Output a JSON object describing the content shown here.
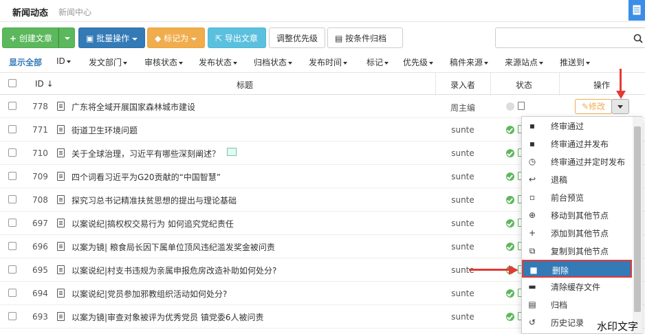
{
  "header": {
    "title": "新闻动态",
    "breadcrumb": "新闻中心"
  },
  "toolbar": {
    "create": "创建文章",
    "batch": "批量操作",
    "mark_as": "标记为",
    "export": "导出文章",
    "priority": "调整优先级",
    "archive": "按条件归档",
    "search_placeholder": ""
  },
  "filters": [
    "显示全部",
    "ID",
    "发文部门",
    "审核状态",
    "发布状态",
    "归档状态",
    "发布时间",
    "标记",
    "优先级",
    "稿件来源",
    "来源站点",
    "推送到"
  ],
  "table": {
    "headers": {
      "id": "ID",
      "title": "标题",
      "author": "录入者",
      "status": "状态",
      "action": "操作"
    },
    "rows": [
      {
        "id": "778",
        "title": "广东将全域开展国家森林城市建设",
        "author": "周主编"
      },
      {
        "id": "771",
        "title": "街道卫生环境问题",
        "author": "sunte"
      },
      {
        "id": "710",
        "title": "关于全球治理，习近平有哪些深刻阐述？",
        "author": "sunte"
      },
      {
        "id": "709",
        "title": "四个词看习近平为G20贡献的“中国智慧”",
        "author": "sunte"
      },
      {
        "id": "708",
        "title": "探究习总书记精准扶贫思想的提出与理论基础",
        "author": "sunte"
      },
      {
        "id": "697",
        "title": "以案说纪|搞权权交易行为 如何追究党纪责任",
        "author": "sunte"
      },
      {
        "id": "696",
        "title": "以案为镜| 粮食局长因下属单位顶风违纪滥发奖金被问责",
        "author": "sunte"
      },
      {
        "id": "695",
        "title": "以案说纪|村支书违规为亲属申报危房改造补助如何处分?",
        "author": "sunte"
      },
      {
        "id": "694",
        "title": "以案说纪|党员参加邪教组织活动如何处分?",
        "author": "sunte"
      },
      {
        "id": "693",
        "title": "以案为镜|审查对象被评为优秀党员 镇党委6人被问责",
        "author": "sunte"
      }
    ],
    "edit_label": "修改"
  },
  "menu": {
    "items": [
      {
        "label": "终审通过",
        "icon": "approve-icon"
      },
      {
        "label": "终审通过并发布",
        "icon": "approve-publish-icon"
      },
      {
        "label": "终审通过并定时发布",
        "icon": "clock-icon"
      },
      {
        "label": "退稿",
        "icon": "return-icon"
      },
      {
        "label": "前台预览",
        "icon": "preview-icon"
      },
      {
        "label": "移动到其他节点",
        "icon": "move-icon"
      },
      {
        "label": "添加到其他节点",
        "icon": "plus-icon"
      },
      {
        "label": "复制到其他节点",
        "icon": "copy-icon"
      },
      {
        "label": "删除",
        "icon": "trash-icon",
        "selected": true
      },
      {
        "label": "清除缓存文件",
        "icon": "broom-icon"
      },
      {
        "label": "归档",
        "icon": "archive-icon"
      },
      {
        "label": "历史记录",
        "icon": "history-icon"
      }
    ]
  },
  "watermark": "水印文字",
  "colors": {
    "accent": "#337ab7",
    "success": "#5cb85c",
    "warning": "#f0ad4e",
    "highlight": "#e53935"
  }
}
